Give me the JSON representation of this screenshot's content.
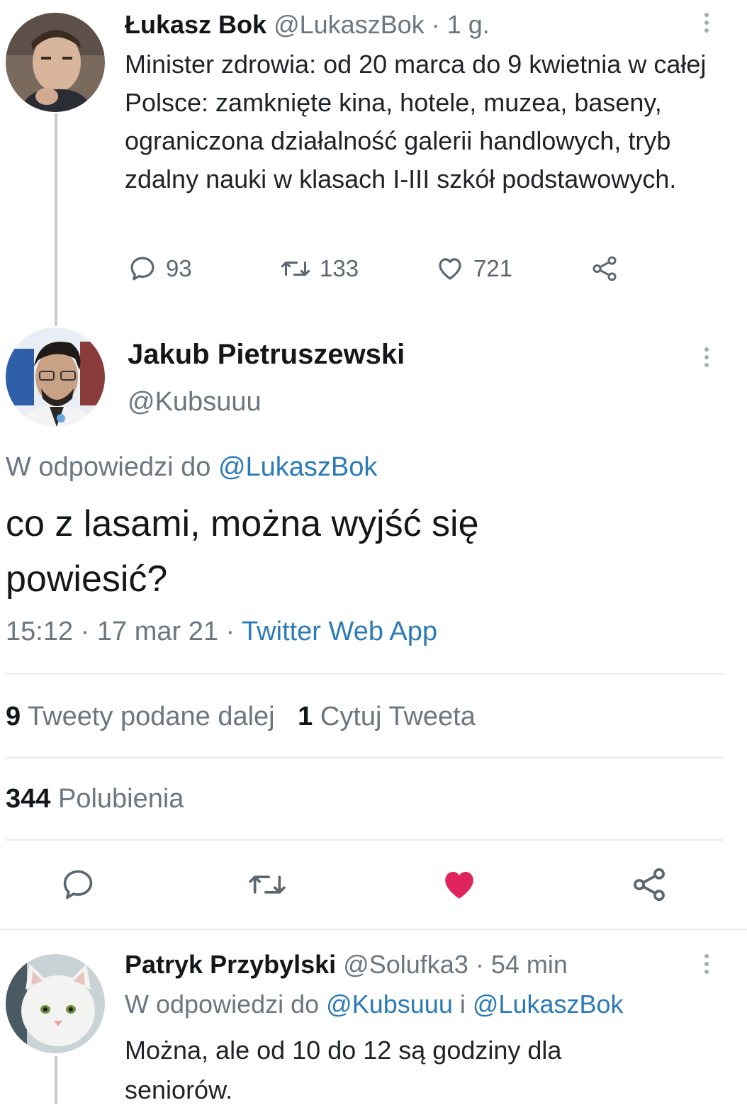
{
  "tweet1": {
    "name": "Łukasz Bok",
    "handle": "@LukaszBok",
    "sep": "·",
    "time": "1 g.",
    "text": "Minister zdrowia: od 20 marca do 9 kwietnia w całej Polsce: zamknięte kina, hotele, muzea, baseny, ograniczona działalność galerii handlowych, tryb zdalny nauki w klasach I-III szkół podstawowych.",
    "replies": "93",
    "retweets": "133",
    "likes": "721"
  },
  "tweet2": {
    "name": "Jakub Pietruszewski",
    "handle": "@Kubsuuu",
    "reply_prefix": "W odpowiedzi do",
    "reply_to": "@LukaszBok",
    "text": "co z lasami, można wyjść się powiesić?",
    "time": "15:12",
    "dot": "·",
    "date": "17 mar 21",
    "dot2": "·",
    "client": "Twitter Web App",
    "retweets_num": "9",
    "retweets_label": "Tweety podane dalej",
    "quotes_num": "1",
    "quotes_label": "Cytuj Tweeta",
    "likes_num": "344",
    "likes_label": "Polubienia"
  },
  "tweet3": {
    "name": "Patryk Przybylski",
    "handle": "@Solufka3",
    "sep": "·",
    "time": "54 min",
    "reply_prefix": "W odpowiedzi do",
    "reply_to_1": "@Kubsuuu",
    "reply_and": "i",
    "reply_to_2": "@LukaszBok",
    "text": "Można, ale od 10 do 12 są godziny dla seniorów."
  },
  "icons": {
    "reply": "reply-icon",
    "retweet": "retweet-icon",
    "like": "heart-icon",
    "share": "share-icon",
    "more": "more-icon"
  },
  "colors": {
    "link": "#2b7bb9",
    "liked": "#e0245e",
    "muted": "#6b7680"
  }
}
